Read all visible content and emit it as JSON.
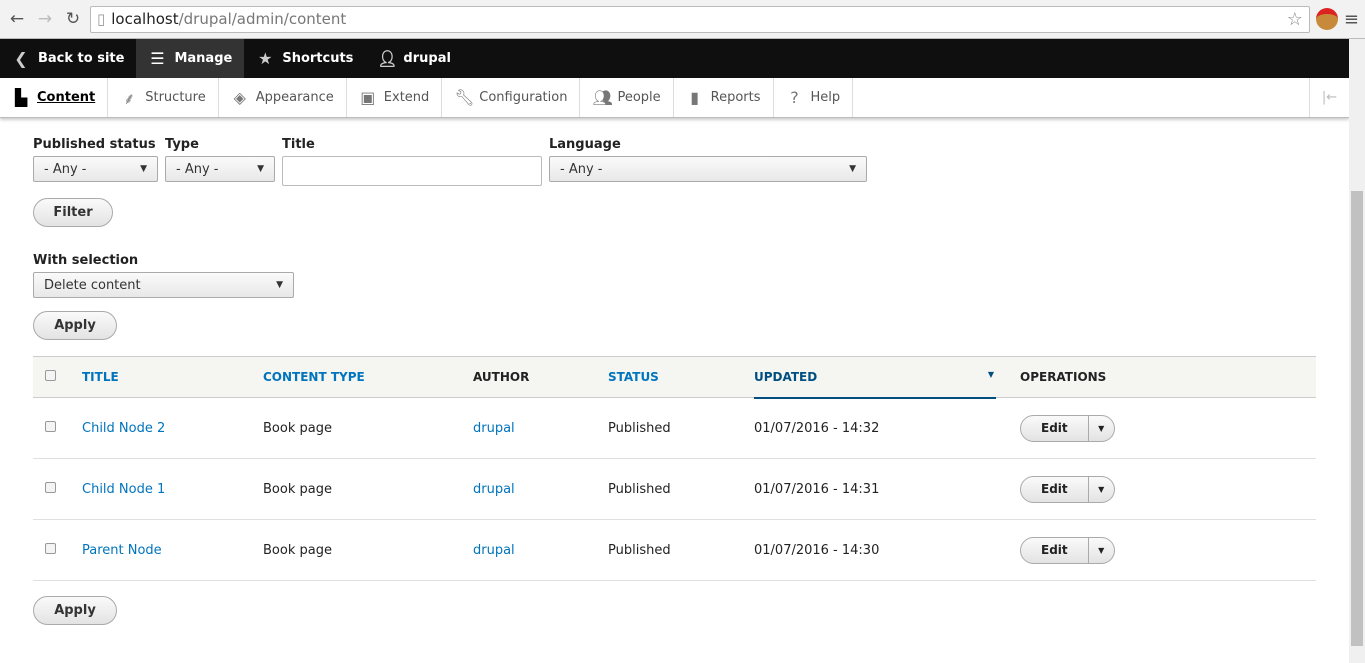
{
  "browser": {
    "url_host": "localhost",
    "url_path": "/drupal/admin/content"
  },
  "toolbar": {
    "back": "Back to site",
    "manage": "Manage",
    "shortcuts": "Shortcuts",
    "user": "drupal"
  },
  "tray": [
    "Content",
    "Structure",
    "Appearance",
    "Extend",
    "Configuration",
    "People",
    "Reports",
    "Help"
  ],
  "filters": {
    "published_label": "Published status",
    "published_value": "- Any -",
    "type_label": "Type",
    "type_value": "- Any -",
    "title_label": "Title",
    "title_value": "",
    "language_label": "Language",
    "language_value": "- Any -",
    "filter_button": "Filter"
  },
  "bulk": {
    "label": "With selection",
    "value": "Delete content",
    "apply": "Apply"
  },
  "table": {
    "headers": {
      "title": "TITLE",
      "type": "CONTENT TYPE",
      "author": "AUTHOR",
      "status": "STATUS",
      "updated": "UPDATED",
      "operations": "OPERATIONS"
    },
    "rows": [
      {
        "title": "Child Node 2",
        "type": "Book page",
        "author": "drupal",
        "status": "Published",
        "updated": "01/07/2016 - 14:32",
        "op": "Edit"
      },
      {
        "title": "Child Node 1",
        "type": "Book page",
        "author": "drupal",
        "status": "Published",
        "updated": "01/07/2016 - 14:31",
        "op": "Edit"
      },
      {
        "title": "Parent Node",
        "type": "Book page",
        "author": "drupal",
        "status": "Published",
        "updated": "01/07/2016 - 14:30",
        "op": "Edit"
      }
    ]
  },
  "bottom_apply": "Apply"
}
